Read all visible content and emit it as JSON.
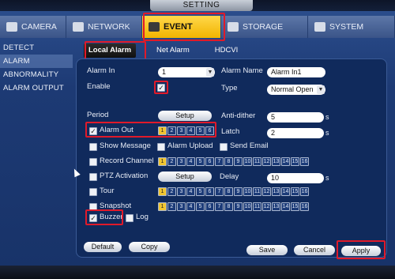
{
  "window": {
    "title": "SETTING"
  },
  "top_tabs": [
    {
      "label": "CAMERA",
      "icon": "camera-icon"
    },
    {
      "label": "NETWORK",
      "icon": "network-icon"
    },
    {
      "label": "EVENT",
      "icon": "event-icon",
      "active": true
    },
    {
      "label": "STORAGE",
      "icon": "storage-icon"
    },
    {
      "label": "SYSTEM",
      "icon": "system-icon"
    }
  ],
  "left_nav": [
    "DETECT",
    "ALARM",
    "ABNORMALITY",
    "ALARM OUTPUT"
  ],
  "sub_tabs": [
    "Local Alarm",
    "Net Alarm",
    "HDCVI"
  ],
  "form": {
    "alarm_in_label": "Alarm In",
    "alarm_in_value": "1",
    "alarm_name_label": "Alarm Name",
    "alarm_name_value": "Alarm In1",
    "enable_label": "Enable",
    "type_label": "Type",
    "type_value": "Normal Open",
    "period_label": "Period",
    "setup_label": "Setup",
    "anti_dither_label": "Anti-dither",
    "anti_dither_value": "5",
    "anti_dither_unit": "s",
    "alarm_out_label": "Alarm Out",
    "latch_label": "Latch",
    "latch_value": "2",
    "latch_unit": "s",
    "show_message_label": "Show Message",
    "alarm_upload_label": "Alarm Upload",
    "send_email_label": "Send Email",
    "record_channel_label": "Record Channel",
    "ptz_activation_label": "PTZ Activation",
    "ptz_setup_label": "Setup",
    "delay_label": "Delay",
    "delay_value": "10",
    "delay_unit": "s",
    "tour_label": "Tour",
    "snapshot_label": "Snapshot",
    "buzzer_label": "Buzzer",
    "log_label": "Log"
  },
  "alarm_out_channels": [
    "1",
    "2",
    "3",
    "4",
    "5",
    "6"
  ],
  "channels_16": [
    "1",
    "2",
    "3",
    "4",
    "5",
    "6",
    "7",
    "8",
    "9",
    "10",
    "11",
    "12",
    "13",
    "14",
    "15",
    "16"
  ],
  "buttons": {
    "default": "Default",
    "copy": "Copy",
    "save": "Save",
    "cancel": "Cancel",
    "apply": "Apply"
  },
  "colors": {
    "highlight": "#e01a2a",
    "active_tab": "#f1b400",
    "panel": "#102a5c"
  }
}
